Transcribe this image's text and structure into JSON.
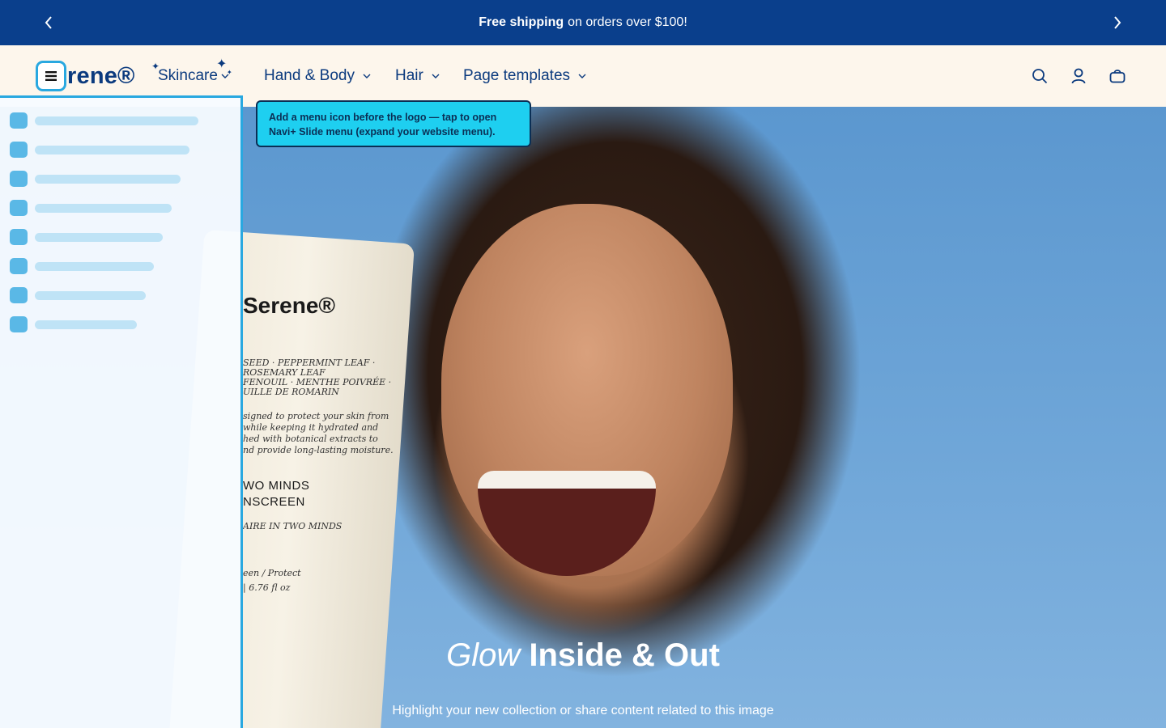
{
  "announcement": {
    "bold": "Free shipping",
    "text": "on orders over $100!"
  },
  "logo": {
    "text": "rene®"
  },
  "nav": [
    {
      "label": "Skincare"
    },
    {
      "label": "Hand & Body"
    },
    {
      "label": "Hair"
    },
    {
      "label": "Page templates"
    }
  ],
  "header_icons": [
    "search-icon",
    "account-icon",
    "cart-icon"
  ],
  "tooltip": {
    "line1": "Add a menu icon before the logo — tap to open",
    "line2": "Navi+ Slide menu (expand your website menu)."
  },
  "hero": {
    "title_italic": "Glow",
    "title_rest": "Inside & Out",
    "subtitle": "Highlight your new collection or share content related to this image",
    "product": {
      "brand": "Serene®",
      "ingredients": [
        "SEED · PEPPERMINT LEAF ·",
        "ROSEMARY LEAF",
        "FENOUIL · MENTHE POIVRÉE ·",
        "UILLE DE ROMARIN"
      ],
      "description": [
        "signed to protect your skin from",
        "while keeping it hydrated and",
        "hed with botanical extracts to",
        "nd provide long-lasting moisture."
      ],
      "name": [
        "WO MINDS",
        "NSCREEN",
        "AIRE IN TWO MINDS"
      ],
      "footer": [
        "een / Protect",
        "| 6.76 fl oz"
      ]
    }
  },
  "colors": {
    "announcement_bg": "#0a3f8c",
    "header_bg": "#fdf6ec",
    "brand_text": "#0b3a7e",
    "accent": "#29a8e0",
    "tooltip_bg": "#1ecff0"
  }
}
